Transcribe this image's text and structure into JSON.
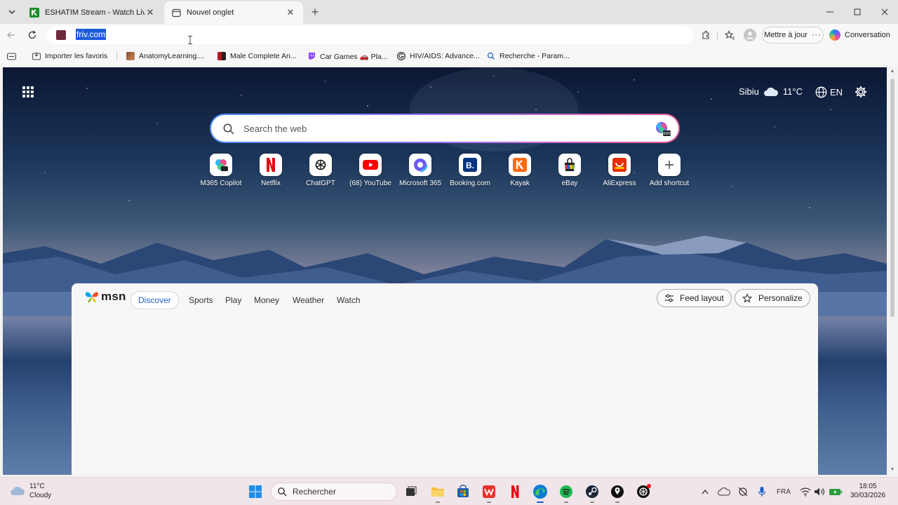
{
  "browser": {
    "tabs": [
      {
        "label": "ESHATIM Stream - Watch Live on",
        "favicon": "eshatim-k-icon",
        "active": false
      },
      {
        "label": "Nouvel onglet",
        "favicon": "new-tab-icon",
        "active": true
      }
    ],
    "address": {
      "value": "friv.com"
    },
    "update_label": "Mettre à jour",
    "conversation_label": "Conversation",
    "favorites": [
      {
        "label": "Importer les favoris",
        "icon": "import-icon"
      },
      {
        "label": "AnatomyLearning....",
        "icon": "anatomy-icon"
      },
      {
        "label": "Male Complete An...",
        "icon": "anatomy2-icon"
      },
      {
        "label": "Car Games 🚗 Pla...",
        "icon": "twitch-icon"
      },
      {
        "label": "HIV/AIDS: Advance...",
        "icon": "g-icon"
      },
      {
        "label": "Recherche - Param...",
        "icon": "search-icon"
      }
    ]
  },
  "newtab": {
    "weather": {
      "city": "Sibiu",
      "temp": "11°C"
    },
    "language": "EN",
    "search_placeholder": "Search the web",
    "shortcuts": [
      {
        "label": "M365 Copilot",
        "icon": "m365-copilot-icon"
      },
      {
        "label": "Netflix",
        "icon": "netflix-icon"
      },
      {
        "label": "ChatGPT",
        "icon": "chatgpt-icon"
      },
      {
        "label": "(68) YouTube",
        "icon": "youtube-icon"
      },
      {
        "label": "Microsoft 365",
        "icon": "microsoft365-icon"
      },
      {
        "label": "Booking.com",
        "icon": "booking-icon"
      },
      {
        "label": "Kayak",
        "icon": "kayak-icon"
      },
      {
        "label": "eBay",
        "icon": "ebay-icon"
      },
      {
        "label": "AliExpress",
        "icon": "aliexpress-icon"
      },
      {
        "label": "Add shortcut",
        "icon": "plus-icon"
      }
    ],
    "feed": {
      "brand": "msn",
      "tabs": [
        "Discover",
        "Sports",
        "Play",
        "Money",
        "Weather",
        "Watch"
      ],
      "active_tab": "Discover",
      "feed_layout_label": "Feed layout",
      "personalize_label": "Personalize"
    }
  },
  "taskbar": {
    "weather": {
      "temp": "11°C",
      "desc": "Cloudy"
    },
    "search_label": "Rechercher",
    "language": "FRA",
    "time": "18:05",
    "date": "30/03/2026"
  },
  "colors": {
    "accent": "#1f5fc8",
    "selection": "#1d5bd6",
    "netflix": "#e50914",
    "youtube": "#ff0000"
  }
}
